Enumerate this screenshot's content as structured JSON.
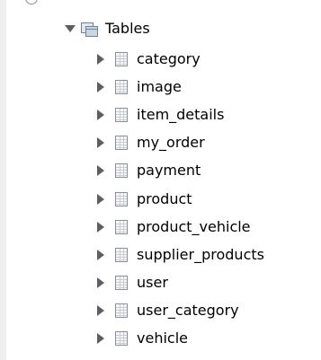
{
  "tree": {
    "folder": {
      "label": "Tables",
      "expanded": true,
      "icon": "tables-folder-icon"
    },
    "tables": [
      {
        "label": "category"
      },
      {
        "label": "image"
      },
      {
        "label": "item_details"
      },
      {
        "label": "my_order"
      },
      {
        "label": "payment"
      },
      {
        "label": "product"
      },
      {
        "label": "product_vehicle"
      },
      {
        "label": "supplier_products"
      },
      {
        "label": "user"
      },
      {
        "label": "user_category"
      },
      {
        "label": "vehicle"
      }
    ],
    "item_icon": "table-icon",
    "collapsed_icon": "expand-arrow-icon"
  }
}
